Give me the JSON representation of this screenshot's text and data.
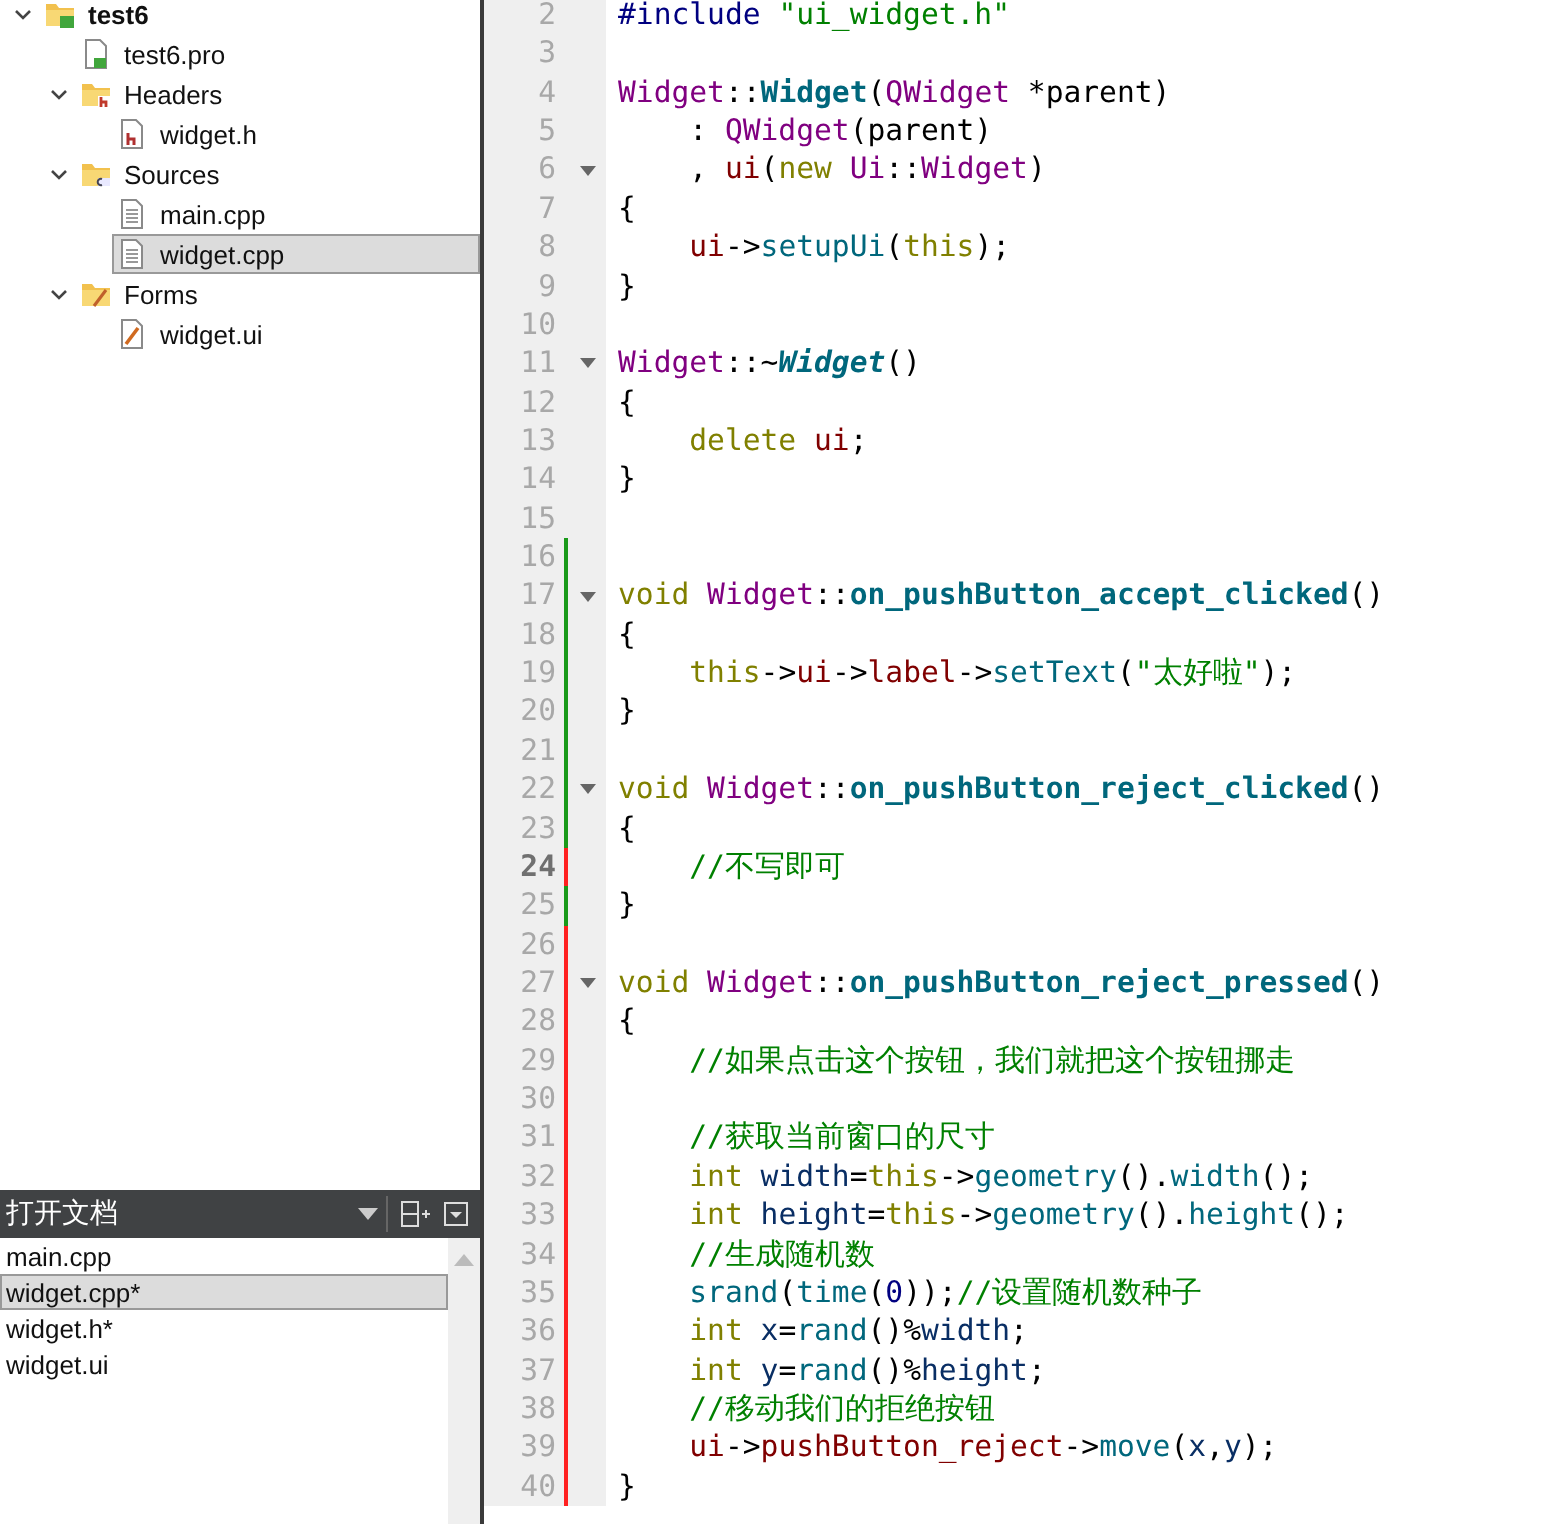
{
  "project_tree": [
    {
      "label": "test6",
      "kind": "project",
      "expanded": true,
      "selected": false,
      "children": [
        {
          "label": "test6.pro",
          "kind": "pro-file",
          "selected": false
        },
        {
          "label": "Headers",
          "kind": "header-folder",
          "expanded": true,
          "selected": false,
          "children": [
            {
              "label": "widget.h",
              "kind": "header-file",
              "selected": false
            }
          ]
        },
        {
          "label": "Sources",
          "kind": "source-folder",
          "expanded": true,
          "selected": false,
          "children": [
            {
              "label": "main.cpp",
              "kind": "source-file",
              "selected": false
            },
            {
              "label": "widget.cpp",
              "kind": "source-file",
              "selected": true
            }
          ]
        },
        {
          "label": "Forms",
          "kind": "form-folder",
          "expanded": true,
          "selected": false,
          "children": [
            {
              "label": "widget.ui",
              "kind": "form-file",
              "selected": false
            }
          ]
        }
      ]
    }
  ],
  "open_documents": {
    "title": "打开文档",
    "items": [
      {
        "label": "main.cpp",
        "selected": false
      },
      {
        "label": "widget.cpp*",
        "selected": true
      },
      {
        "label": "widget.h*",
        "selected": false
      },
      {
        "label": "widget.ui",
        "selected": false
      }
    ]
  },
  "editor": {
    "lines": [
      {
        "number": "2",
        "foldable": false,
        "current": false,
        "tokens": [
          {
            "kind": "preproc",
            "text": "#include "
          },
          {
            "kind": "string",
            "text": "\"ui_widget.h\""
          }
        ]
      },
      {
        "number": "3",
        "foldable": false,
        "current": false
      },
      {
        "number": "4",
        "foldable": false,
        "current": false,
        "tokens": [
          {
            "kind": "type",
            "text": "Widget"
          },
          {
            "kind": "plain",
            "text": "::"
          },
          {
            "kind": "decl",
            "text": "Widget"
          },
          {
            "kind": "plain",
            "text": "("
          },
          {
            "kind": "type",
            "text": "QWidget"
          },
          {
            "kind": "plain",
            "text": " *parent)"
          }
        ]
      },
      {
        "number": "5",
        "foldable": false,
        "current": false,
        "tokens": [
          {
            "kind": "plain",
            "text": "    : "
          },
          {
            "kind": "type",
            "text": "QWidget"
          },
          {
            "kind": "plain",
            "text": "(parent)"
          }
        ]
      },
      {
        "number": "6",
        "foldable": true,
        "current": false,
        "tokens": [
          {
            "kind": "plain",
            "text": "    , "
          },
          {
            "kind": "member",
            "text": "ui"
          },
          {
            "kind": "plain",
            "text": "("
          },
          {
            "kind": "keyword",
            "text": "new "
          },
          {
            "kind": "type",
            "text": "Ui"
          },
          {
            "kind": "plain",
            "text": "::"
          },
          {
            "kind": "type",
            "text": "Widget"
          },
          {
            "kind": "plain",
            "text": ")"
          }
        ]
      },
      {
        "number": "7",
        "foldable": false,
        "current": false,
        "tokens": [
          {
            "kind": "plain",
            "text": "{"
          }
        ]
      },
      {
        "number": "8",
        "foldable": false,
        "current": false,
        "tokens": [
          {
            "kind": "member",
            "text": "    ui"
          },
          {
            "kind": "plain",
            "text": "->"
          },
          {
            "kind": "function",
            "text": "setupUi"
          },
          {
            "kind": "plain",
            "text": "("
          },
          {
            "kind": "keyword",
            "text": "this"
          },
          {
            "kind": "plain",
            "text": ");"
          }
        ]
      },
      {
        "number": "9",
        "foldable": false,
        "current": false,
        "tokens": [
          {
            "kind": "plain",
            "text": "}"
          }
        ]
      },
      {
        "number": "10",
        "foldable": false,
        "current": false
      },
      {
        "number": "11",
        "foldable": true,
        "current": false,
        "tokens": [
          {
            "kind": "type",
            "text": "Widget"
          },
          {
            "kind": "plain",
            "text": "::~"
          },
          {
            "kind": "destructor",
            "text": "Widget"
          },
          {
            "kind": "plain",
            "text": "()"
          }
        ]
      },
      {
        "number": "12",
        "foldable": false,
        "current": false,
        "tokens": [
          {
            "kind": "plain",
            "text": "{"
          }
        ]
      },
      {
        "number": "13",
        "foldable": false,
        "current": false,
        "tokens": [
          {
            "kind": "keyword",
            "text": "    delete "
          },
          {
            "kind": "member",
            "text": "ui"
          },
          {
            "kind": "plain",
            "text": ";"
          }
        ]
      },
      {
        "number": "14",
        "foldable": false,
        "current": false,
        "tokens": [
          {
            "kind": "plain",
            "text": "}"
          }
        ]
      },
      {
        "number": "15",
        "foldable": false,
        "current": false
      },
      {
        "number": "16",
        "color": "#1a9a1a",
        "foldable": false,
        "current": false
      },
      {
        "number": "17",
        "color": "#1a9a1a",
        "foldable": true,
        "current": false,
        "tokens": [
          {
            "kind": "keyword",
            "text": "void "
          },
          {
            "kind": "type",
            "text": "Widget"
          },
          {
            "kind": "plain",
            "text": "::"
          },
          {
            "kind": "decl",
            "text": "on_pushButton_accept_clicked"
          },
          {
            "kind": "plain",
            "text": "()"
          }
        ]
      },
      {
        "number": "18",
        "color": "#1a9a1a",
        "foldable": false,
        "current": false,
        "tokens": [
          {
            "kind": "plain",
            "text": "{"
          }
        ]
      },
      {
        "number": "19",
        "color": "#1a9a1a",
        "foldable": false,
        "current": false,
        "tokens": [
          {
            "kind": "keyword",
            "text": "    this"
          },
          {
            "kind": "plain",
            "text": "->"
          },
          {
            "kind": "member",
            "text": "ui"
          },
          {
            "kind": "plain",
            "text": "->"
          },
          {
            "kind": "member",
            "text": "label"
          },
          {
            "kind": "plain",
            "text": "->"
          },
          {
            "kind": "function",
            "text": "setText"
          },
          {
            "kind": "plain",
            "text": "("
          },
          {
            "kind": "string",
            "text": "\"太好啦\""
          },
          {
            "kind": "plain",
            "text": ");"
          }
        ]
      },
      {
        "number": "20",
        "color": "#1a9a1a",
        "foldable": false,
        "current": false,
        "tokens": [
          {
            "kind": "plain",
            "text": "}"
          }
        ]
      },
      {
        "number": "21",
        "color": "#1a9a1a",
        "foldable": false,
        "current": false
      },
      {
        "number": "22",
        "color": "#1a9a1a",
        "foldable": true,
        "current": false,
        "tokens": [
          {
            "kind": "keyword",
            "text": "void "
          },
          {
            "kind": "type",
            "text": "Widget"
          },
          {
            "kind": "plain",
            "text": "::"
          },
          {
            "kind": "decl",
            "text": "on_pushButton_reject_clicked"
          },
          {
            "kind": "plain",
            "text": "()"
          }
        ]
      },
      {
        "number": "23",
        "color": "#1a9a1a",
        "foldable": false,
        "current": false,
        "tokens": [
          {
            "kind": "plain",
            "text": "{"
          }
        ]
      },
      {
        "number": "24",
        "color": "#ff2020",
        "foldable": false,
        "current": true,
        "tokens": [
          {
            "kind": "comment",
            "text": "    //不写即可"
          }
        ]
      },
      {
        "number": "25",
        "color": "#1a9a1a",
        "foldable": false,
        "current": false,
        "tokens": [
          {
            "kind": "plain",
            "text": "}"
          }
        ]
      },
      {
        "number": "26",
        "color": "#ff2020",
        "foldable": false,
        "current": false
      },
      {
        "number": "27",
        "color": "#ff2020",
        "foldable": true,
        "current": false,
        "tokens": [
          {
            "kind": "keyword",
            "text": "void "
          },
          {
            "kind": "type",
            "text": "Widget"
          },
          {
            "kind": "plain",
            "text": "::"
          },
          {
            "kind": "decl",
            "text": "on_pushButton_reject_pressed"
          },
          {
            "kind": "plain",
            "text": "()"
          }
        ]
      },
      {
        "number": "28",
        "color": "#ff2020",
        "foldable": false,
        "current": false,
        "tokens": [
          {
            "kind": "plain",
            "text": "{"
          }
        ]
      },
      {
        "number": "29",
        "color": "#ff2020",
        "foldable": false,
        "current": false,
        "tokens": [
          {
            "kind": "comment",
            "text": "    //如果点击这个按钮，我们就把这个按钮挪走"
          }
        ]
      },
      {
        "number": "30",
        "color": "#ff2020",
        "foldable": false,
        "current": false
      },
      {
        "number": "31",
        "color": "#ff2020",
        "foldable": false,
        "current": false,
        "tokens": [
          {
            "kind": "comment",
            "text": "    //获取当前窗口的尺寸"
          }
        ]
      },
      {
        "number": "32",
        "color": "#ff2020",
        "foldable": false,
        "current": false,
        "tokens": [
          {
            "kind": "keyword",
            "text": "    int "
          },
          {
            "kind": "local",
            "text": "width"
          },
          {
            "kind": "plain",
            "text": "="
          },
          {
            "kind": "keyword",
            "text": "this"
          },
          {
            "kind": "plain",
            "text": "->"
          },
          {
            "kind": "function",
            "text": "geometry"
          },
          {
            "kind": "plain",
            "text": "()."
          },
          {
            "kind": "function",
            "text": "width"
          },
          {
            "kind": "plain",
            "text": "();"
          }
        ]
      },
      {
        "number": "33",
        "color": "#ff2020",
        "foldable": false,
        "current": false,
        "tokens": [
          {
            "kind": "keyword",
            "text": "    int "
          },
          {
            "kind": "local",
            "text": "height"
          },
          {
            "kind": "plain",
            "text": "="
          },
          {
            "kind": "keyword",
            "text": "this"
          },
          {
            "kind": "plain",
            "text": "->"
          },
          {
            "kind": "function",
            "text": "geometry"
          },
          {
            "kind": "plain",
            "text": "()."
          },
          {
            "kind": "function",
            "text": "height"
          },
          {
            "kind": "plain",
            "text": "();"
          }
        ]
      },
      {
        "number": "34",
        "color": "#ff2020",
        "foldable": false,
        "current": false,
        "tokens": [
          {
            "kind": "comment",
            "text": "    //生成随机数"
          }
        ]
      },
      {
        "number": "35",
        "color": "#ff2020",
        "foldable": false,
        "current": false,
        "tokens": [
          {
            "kind": "function",
            "text": "    srand"
          },
          {
            "kind": "plain",
            "text": "("
          },
          {
            "kind": "function",
            "text": "time"
          },
          {
            "kind": "plain",
            "text": "("
          },
          {
            "kind": "number",
            "text": "0"
          },
          {
            "kind": "plain",
            "text": "));"
          },
          {
            "kind": "comment",
            "text": "//设置随机数种子"
          }
        ]
      },
      {
        "number": "36",
        "color": "#ff2020",
        "foldable": false,
        "current": false,
        "tokens": [
          {
            "kind": "keyword",
            "text": "    int "
          },
          {
            "kind": "local",
            "text": "x"
          },
          {
            "kind": "plain",
            "text": "="
          },
          {
            "kind": "function",
            "text": "rand"
          },
          {
            "kind": "plain",
            "text": "()%"
          },
          {
            "kind": "local",
            "text": "width"
          },
          {
            "kind": "plain",
            "text": ";"
          }
        ]
      },
      {
        "number": "37",
        "color": "#ff2020",
        "foldable": false,
        "current": false,
        "tokens": [
          {
            "kind": "keyword",
            "text": "    int "
          },
          {
            "kind": "local",
            "text": "y"
          },
          {
            "kind": "plain",
            "text": "="
          },
          {
            "kind": "function",
            "text": "rand"
          },
          {
            "kind": "plain",
            "text": "()%"
          },
          {
            "kind": "local",
            "text": "height"
          },
          {
            "kind": "plain",
            "text": ";"
          }
        ]
      },
      {
        "number": "38",
        "color": "#ff2020",
        "foldable": false,
        "current": false,
        "tokens": [
          {
            "kind": "comment",
            "text": "    //移动我们的拒绝按钮"
          }
        ]
      },
      {
        "number": "39",
        "color": "#ff2020",
        "foldable": false,
        "current": false,
        "tokens": [
          {
            "kind": "member",
            "text": "    ui"
          },
          {
            "kind": "plain",
            "text": "->"
          },
          {
            "kind": "member",
            "text": "pushButton_reject"
          },
          {
            "kind": "plain",
            "text": "->"
          },
          {
            "kind": "function",
            "text": "move"
          },
          {
            "kind": "plain",
            "text": "("
          },
          {
            "kind": "local",
            "text": "x"
          },
          {
            "kind": "plain",
            "text": ","
          },
          {
            "kind": "local",
            "text": "y"
          },
          {
            "kind": "plain",
            "text": ");"
          }
        ]
      },
      {
        "number": "40",
        "color": "#ff2020",
        "foldable": false,
        "current": false,
        "tokens": [
          {
            "kind": "plain",
            "text": "}"
          }
        ]
      }
    ]
  }
}
